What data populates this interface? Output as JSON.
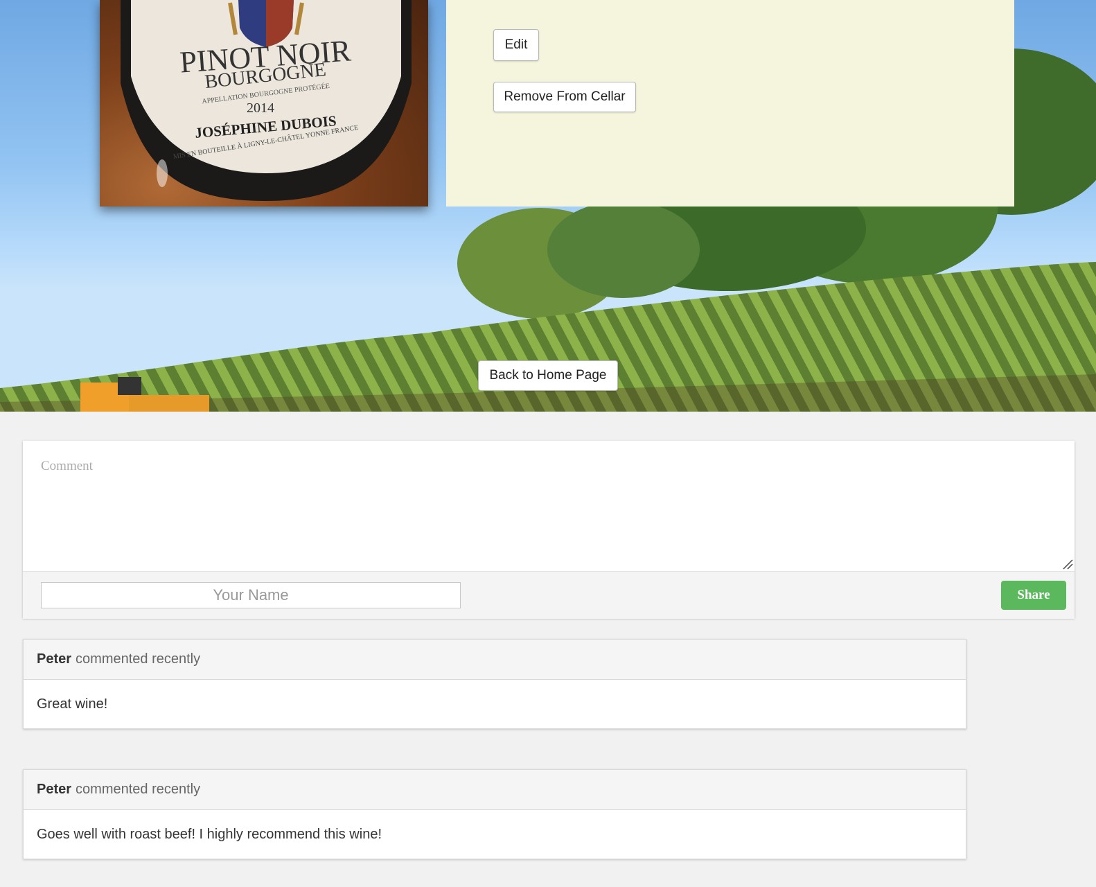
{
  "details": {
    "edit_label": "Edit",
    "remove_label": "Remove From Cellar"
  },
  "bottle_label": {
    "variety": "PINOT NOIR",
    "region": "BOURGOGNE",
    "appellation": "APPELLATION BOURGOGNE PROTÉGÉE",
    "vintage": "2014",
    "producer": "JOSÉPHINE DUBOIS",
    "bottled": "MIS EN BOUTEILLE À LIGNY-LE-CHÂTEL YONNE FRANCE"
  },
  "navigation": {
    "home_label": "Back to Home Page"
  },
  "comment_form": {
    "comment_placeholder": "Comment",
    "name_placeholder": "Your Name",
    "share_label": "Share"
  },
  "comments": [
    {
      "author": "Peter",
      "meta": "commented recently",
      "text": "Great wine!"
    },
    {
      "author": "Peter",
      "meta": "commented recently",
      "text": "Goes well with roast beef! I highly recommend this wine!"
    }
  ],
  "colors": {
    "panel": "#f5f5dd",
    "share_button": "#5cb85c"
  }
}
